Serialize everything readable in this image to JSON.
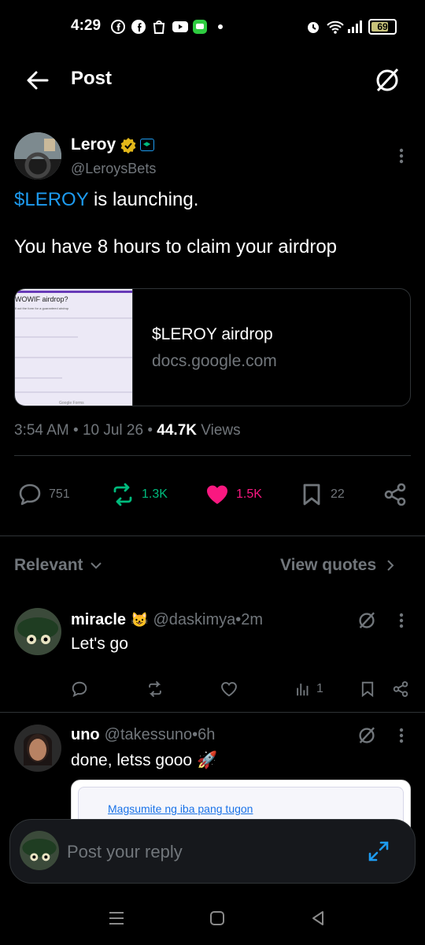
{
  "status_bar": {
    "time": "4:29",
    "battery": "69",
    "icons": [
      "facebook-icon",
      "facebook-icon",
      "shop-icon",
      "youtube-icon",
      "messages-icon",
      "dot-icon",
      "alarm-icon",
      "wifi-icon",
      "signal-icon",
      "battery-icon"
    ]
  },
  "header": {
    "title": "Post",
    "back_icon": "arrow-left-icon",
    "grok_icon": "grok-icon"
  },
  "post": {
    "author": {
      "name": "Leroy",
      "handle": "@LeroysBets",
      "verified": true
    },
    "text_cashtag": "$LEROY",
    "text_line1_rest": " is launching.",
    "text_line2": "You have 8 hours to claim your airdrop",
    "card": {
      "title": "$LEROY airdrop",
      "domain": "docs.google.com",
      "thumb_heading": "WOWIF airdrop?",
      "thumb_sub": "ll out the form for a guaranteed airdrop",
      "thumb_footer": "Google Forms"
    },
    "meta": {
      "time": "3:54 AM",
      "sep1": " • ",
      "date": "10 Jul 26",
      "sep2": " • ",
      "views": "44.7K",
      "views_label": " Views"
    },
    "actions": {
      "replies": "751",
      "reposts": "1.3K",
      "likes": "1.5K",
      "bookmarks": "22"
    },
    "colors": {
      "cashtag": "#1d9bf0",
      "repost": "#00ba7c",
      "like": "#f91880"
    }
  },
  "sort": {
    "label": "Relevant",
    "view_quotes": "View quotes"
  },
  "replies": [
    {
      "name": "miracle",
      "emoji": "😺",
      "handle": "@daskimya",
      "sep": " • ",
      "time": "2m",
      "text": "Let's go",
      "views": "1"
    },
    {
      "name": "uno",
      "handle": "@takessuno",
      "sep": " • ",
      "time": "6h",
      "text": "done, letss gooo 🚀",
      "embed_link": "Magsumite ng iba pang tugon"
    }
  ],
  "reply_bar": {
    "placeholder": "Post your reply"
  }
}
